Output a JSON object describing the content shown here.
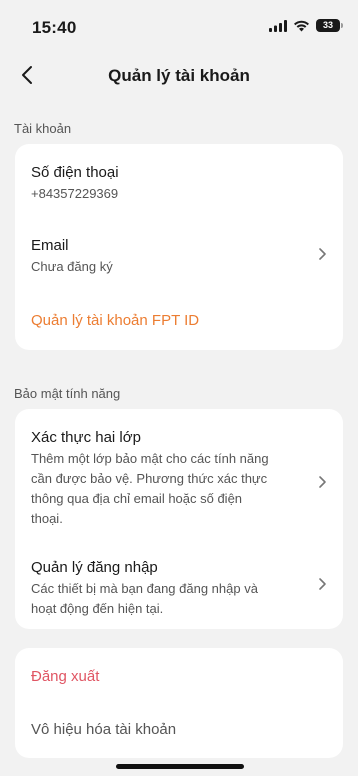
{
  "status_bar": {
    "time": "15:40",
    "battery": "33",
    "icons": [
      "signal-icon",
      "wifi-icon",
      "battery-icon"
    ]
  },
  "nav": {
    "title": "Quản lý tài khoản",
    "back_icon": "chevron-left-icon"
  },
  "account_section": {
    "header": "Tài khoản",
    "phone": {
      "title": "Số điện thoại",
      "value": "+84357229369"
    },
    "email": {
      "title": "Email",
      "value": "Chưa đăng ký"
    },
    "fpt_link": "Quản lý tài khoản FPT ID"
  },
  "security_section": {
    "header": "Bảo mật tính năng",
    "two_factor": {
      "title": "Xác thực hai lớp",
      "description_lines": [
        "Thêm một lớp bảo mật cho các tính năng",
        "cần được bảo vệ. Phương thức xác thực",
        "thông qua địa chỉ email hoặc số điện",
        "thoại."
      ]
    },
    "login_management": {
      "title": "Quản lý đăng nhập",
      "description_lines": [
        "Các thiết bị mà bạn đang đăng nhập và",
        "hoạt động đến hiện tại."
      ]
    }
  },
  "actions": {
    "logout": "Đăng xuất",
    "deactivate": "Vô hiệu hóa tài khoản"
  },
  "colors": {
    "background": "#f2f2f2",
    "card": "#ffffff",
    "accent_orange": "#ec7d32",
    "danger_red": "#e05563"
  }
}
